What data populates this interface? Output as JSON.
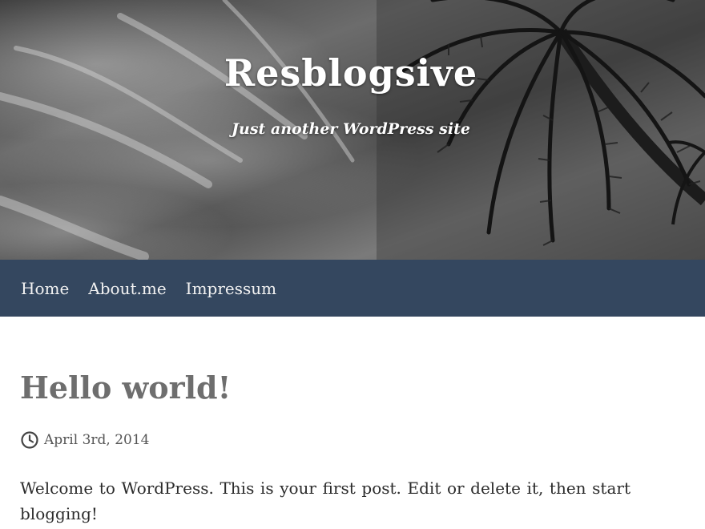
{
  "header": {
    "site_title": "Resblogsive",
    "tagline": "Just another WordPress site"
  },
  "nav": {
    "items": [
      {
        "label": "Home"
      },
      {
        "label": "About.me"
      },
      {
        "label": "Impressum"
      }
    ],
    "background_color": "#34475f"
  },
  "post": {
    "title": "Hello world!",
    "date": "April 3rd, 2014",
    "date_icon": "clock-icon",
    "excerpt": "Welcome to WordPress. This is your first post. Edit or delete it, then start blogging!"
  }
}
